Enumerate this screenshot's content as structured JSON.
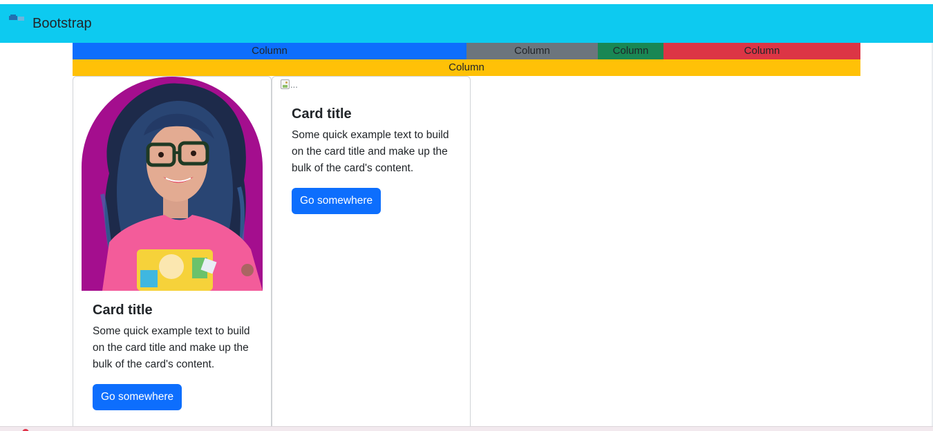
{
  "navbar": {
    "brand_text": "Bootstrap",
    "brand_icon": "bootstrap-logo-icon",
    "background": "#0dcaf0"
  },
  "grid": {
    "row1": [
      {
        "label": "Column",
        "color": "#0d6efd"
      },
      {
        "label": "Column",
        "color": "#6c757d"
      },
      {
        "label": "Column",
        "color": "#198754"
      },
      {
        "label": "Column",
        "color": "#dc3545"
      }
    ],
    "row2": [
      {
        "label": "Column",
        "color": "#ffc107"
      }
    ]
  },
  "cards": [
    {
      "image": "portrait-photo",
      "title": "Card title",
      "text": "Some quick example text to build on the card title and make up the bulk of the card's content.",
      "button_label": "Go somewhere"
    },
    {
      "image_alt": "...",
      "title": "Card title",
      "text": "Some quick example text to build on the card title and make up the bulk of the card's content.",
      "button_label": "Go somewhere"
    }
  ],
  "colors": {
    "primary": "#0d6efd",
    "info": "#0dcaf0",
    "warning": "#ffc107",
    "success": "#198754",
    "danger": "#dc3545",
    "secondary": "#6c757d"
  }
}
